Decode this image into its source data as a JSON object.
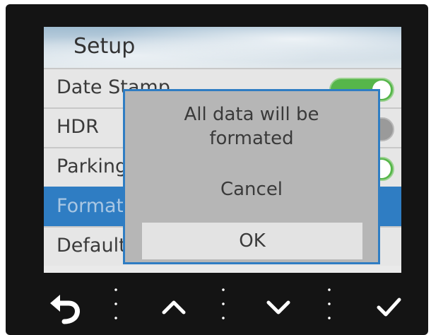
{
  "screen": {
    "title": "Setup",
    "menu": [
      {
        "label": "Date Stamp",
        "toggle": "on"
      },
      {
        "label": "HDR",
        "toggle": "off"
      },
      {
        "label": "Parking",
        "toggle": "on"
      },
      {
        "label": "Format",
        "selected": true
      },
      {
        "label": "Default"
      }
    ]
  },
  "dialog": {
    "message_line1": "All data will be",
    "message_line2": "formated",
    "cancel_label": "Cancel",
    "ok_label": "OK"
  },
  "buttons": {
    "icons": [
      "back-arrow-icon",
      "up-arrow-icon",
      "down-arrow-icon",
      "checkmark-icon"
    ]
  },
  "colors": {
    "highlight": "#2f7dc3",
    "toggle_on": "#56b64a",
    "dialog_bg": "#b6b6b6"
  }
}
